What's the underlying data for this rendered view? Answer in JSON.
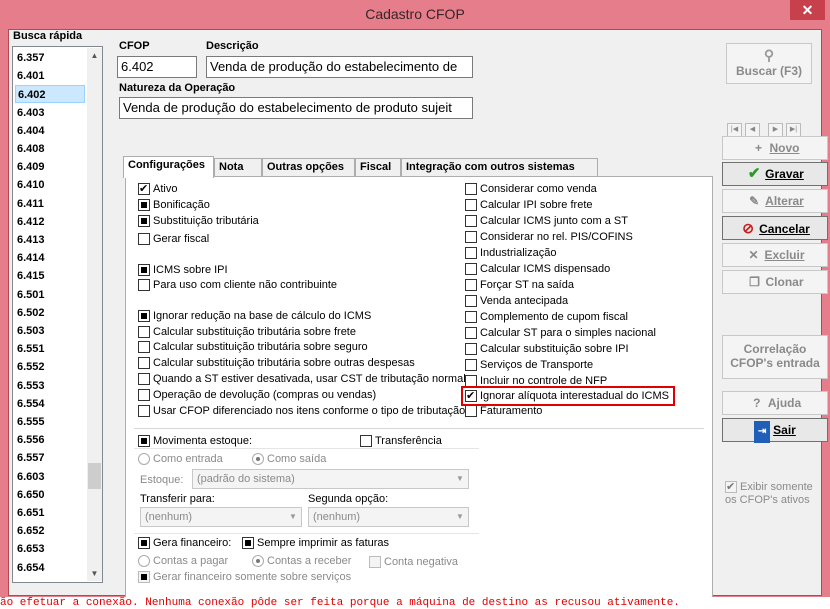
{
  "window": {
    "title": "Cadastro CFOP",
    "close_glyph": "✕"
  },
  "quick_search": {
    "label": "Busca rápida",
    "items": [
      "6.357",
      "6.401",
      "6.402",
      "6.403",
      "6.404",
      "6.408",
      "6.409",
      "6.410",
      "6.411",
      "6.412",
      "6.413",
      "6.414",
      "6.415",
      "6.501",
      "6.502",
      "6.503",
      "6.551",
      "6.552",
      "6.553",
      "6.554",
      "6.555",
      "6.556",
      "6.557",
      "6.603",
      "6.650",
      "6.651",
      "6.652",
      "6.653",
      "6.654"
    ],
    "selected": "6.402"
  },
  "form": {
    "cfop_label": "CFOP",
    "cfop_value": "6.402",
    "descricao_label": "Descrição",
    "descricao_value": "Venda de produção do estabelecimento de",
    "natureza_label": "Natureza da Operação",
    "natureza_value": "Venda de produção do estabelecimento de produto sujeit"
  },
  "tabs": [
    "Configurações",
    "Nota",
    "Outras opções",
    "Fiscal",
    "Integração com outros sistemas"
  ],
  "active_tab": "Configurações",
  "left_options": [
    {
      "label": "Ativo",
      "state": "checked"
    },
    {
      "label": "Bonificação",
      "state": "indeterminate"
    },
    {
      "label": "Substituição tributária",
      "state": "indeterminate"
    },
    {
      "label": "Gerar fiscal",
      "state": "unchecked"
    },
    {
      "label": "ICMS sobre IPI",
      "state": "indeterminate"
    },
    {
      "label": "Para uso com cliente não contribuinte",
      "state": "unchecked"
    },
    {
      "label": "Ignorar redução na base de cálculo do ICMS",
      "state": "indeterminate"
    },
    {
      "label": "Calcular substituição tributária sobre frete",
      "state": "unchecked"
    },
    {
      "label": "Calcular substituição tributária sobre seguro",
      "state": "unchecked"
    },
    {
      "label": "Calcular substituição tributária sobre outras despesas",
      "state": "unchecked"
    },
    {
      "label": "Quando a ST estiver desativada, usar CST de tributação normal",
      "state": "unchecked"
    },
    {
      "label": "Operação de devolução (compras ou vendas)",
      "state": "unchecked"
    },
    {
      "label": "Usar CFOP diferenciado nos itens conforme o tipo de tributação",
      "state": "unchecked"
    }
  ],
  "right_options": [
    {
      "label": "Considerar como venda",
      "state": "unchecked"
    },
    {
      "label": "Calcular IPI sobre frete",
      "state": "unchecked"
    },
    {
      "label": "Calcular ICMS junto com a ST",
      "state": "unchecked"
    },
    {
      "label": "Considerar no rel. PIS/COFINS",
      "state": "unchecked"
    },
    {
      "label": "Industrialização",
      "state": "unchecked"
    },
    {
      "label": "Calcular ICMS dispensado",
      "state": "unchecked"
    },
    {
      "label": "Forçar ST na saída",
      "state": "unchecked"
    },
    {
      "label": "Venda antecipada",
      "state": "unchecked"
    },
    {
      "label": "Complemento de cupom fiscal",
      "state": "unchecked"
    },
    {
      "label": "Calcular ST para o simples nacional",
      "state": "unchecked"
    },
    {
      "label": "Calcular substituição sobre IPI",
      "state": "unchecked"
    },
    {
      "label": "Serviços de Transporte",
      "state": "unchecked"
    },
    {
      "label": "Incluir no controle de NFP",
      "state": "unchecked"
    },
    {
      "label": "Ignorar alíquota interestadual do ICMS",
      "state": "checked"
    },
    {
      "label": "Faturamento",
      "state": "unchecked"
    }
  ],
  "estoque": {
    "movimenta_label": "Movimenta estoque:",
    "transferencia_label": "Transferência",
    "entrada_label": "Como entrada",
    "saida_label": "Como saída",
    "estoque_label": "Estoque:",
    "estoque_value": "(padrão do sistema)",
    "transferir_label": "Transferir para:",
    "transferir_value": "(nenhum)",
    "segunda_label": "Segunda opção:",
    "segunda_value": "(nenhum)"
  },
  "financeiro": {
    "gera_label": "Gera financeiro:",
    "sempre_label": "Sempre imprimir as faturas",
    "pagar_label": "Contas a pagar",
    "receber_label": "Contas a receber",
    "negativa_label": "Conta negativa",
    "servicos_label": "Gerar financeiro somente sobre serviços"
  },
  "buttons": {
    "buscar": "Buscar (F3)",
    "novo": "Novo",
    "gravar": "Gravar",
    "alterar": "Alterar",
    "cancelar": "Cancelar",
    "excluir": "Excluir",
    "clonar": "Clonar",
    "correlacao": "Correlação CFOP's entrada",
    "ajuda": "Ajuda",
    "sair": "Sair"
  },
  "exibir": {
    "label": "Exibir somente os CFOP's ativos"
  },
  "status_error": "ão efetuar a conexão. Nenhuma conexão pôde ser feita porque a máquina de destino as recusou ativamente.",
  "colors": {
    "frame": "#e57e8a",
    "highlight": "#e00000",
    "error": "#e00000",
    "gravar": "#2a9a2a",
    "cancelar": "#c81d1d",
    "sair": "#1f5fb8"
  }
}
